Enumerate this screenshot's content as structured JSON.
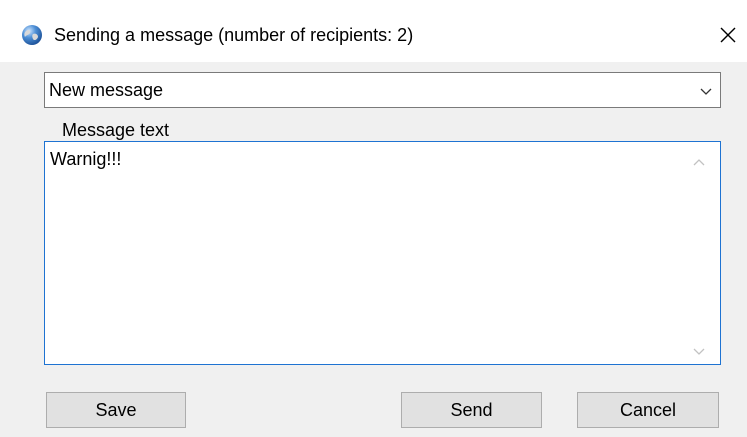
{
  "window": {
    "title": "Sending a message (number of recipients: 2)",
    "app_icon": "globe-icon",
    "close_icon": "close-icon"
  },
  "template_select": {
    "selected": "New message",
    "icon": "chevron-down-icon"
  },
  "message": {
    "label": "Message text",
    "value": "Warnig!!!"
  },
  "buttons": {
    "save": "Save",
    "send": "Send",
    "cancel": "Cancel"
  },
  "colors": {
    "focus_border": "#1e73d2",
    "button_face": "#e1e1e1",
    "dialog_background": "#f0f0f0"
  }
}
